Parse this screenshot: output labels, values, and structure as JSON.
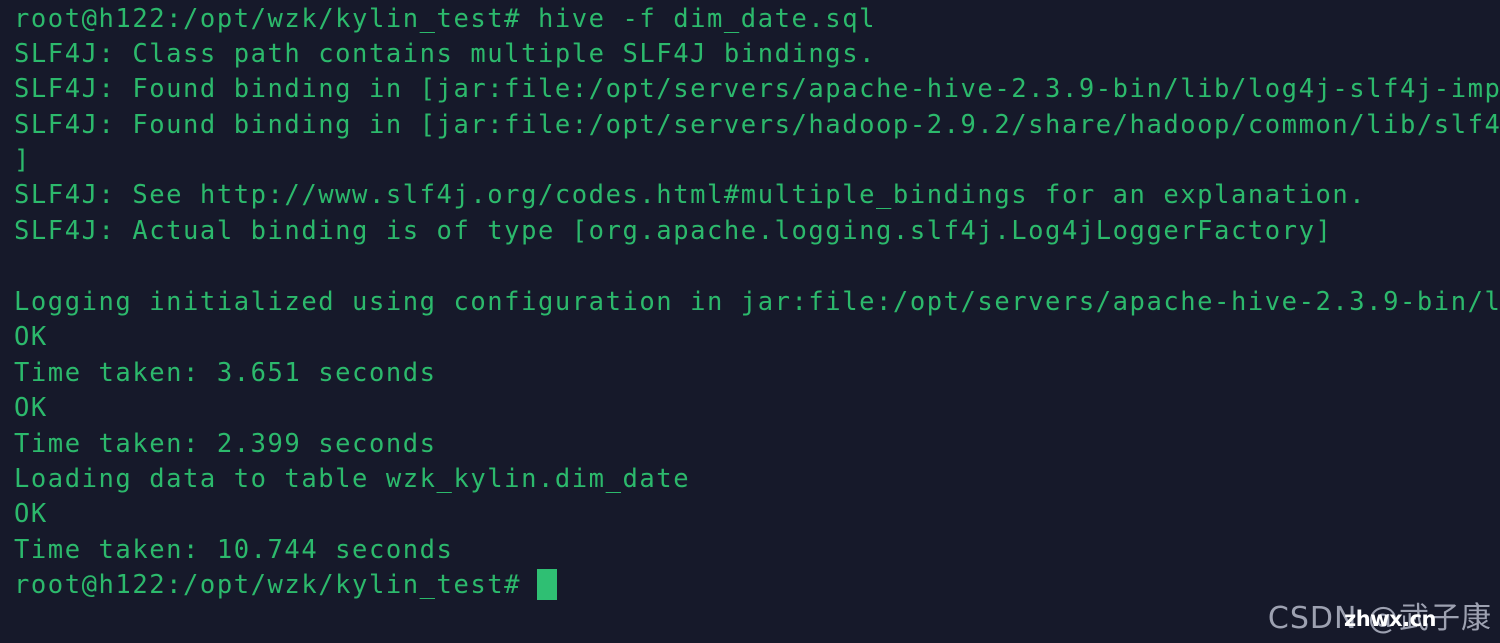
{
  "terminal": {
    "background_color": "#16192a",
    "text_color": "#2cb96c",
    "cursor_color": "#2fbf73",
    "prompt": "root@h122:/opt/wzk/kylin_test#",
    "command": "hive -f dim_date.sql",
    "lines": [
      "root@h122:/opt/wzk/kylin_test# hive -f dim_date.sql",
      "SLF4J: Class path contains multiple SLF4J bindings.",
      "SLF4J: Found binding in [jar:file:/opt/servers/apache-hive-2.3.9-bin/lib/log4j-slf4j-imp",
      "SLF4J: Found binding in [jar:file:/opt/servers/hadoop-2.9.2/share/hadoop/common/lib/slf4",
      "]",
      "SLF4J: See http://www.slf4j.org/codes.html#multiple_bindings for an explanation.",
      "SLF4J: Actual binding is of type [org.apache.logging.slf4j.Log4jLoggerFactory]",
      "",
      "Logging initialized using configuration in jar:file:/opt/servers/apache-hive-2.3.9-bin/l",
      "OK",
      "Time taken: 3.651 seconds",
      "OK",
      "Time taken: 2.399 seconds",
      "Loading data to table wzk_kylin.dim_date",
      "OK",
      "Time taken: 10.744 seconds",
      "root@h122:/opt/wzk/kylin_test# "
    ],
    "timings": {
      "first": "3.651 seconds",
      "second": "2.399 seconds",
      "third": "10.744 seconds"
    },
    "table_loaded": "wzk_kylin.dim_date",
    "status_ok": "OK"
  },
  "watermark": {
    "main": "CSDN @武子康",
    "overlay": "zhwx.cn",
    "color": "#a9adbd",
    "overlay_color": "#ffffff"
  }
}
